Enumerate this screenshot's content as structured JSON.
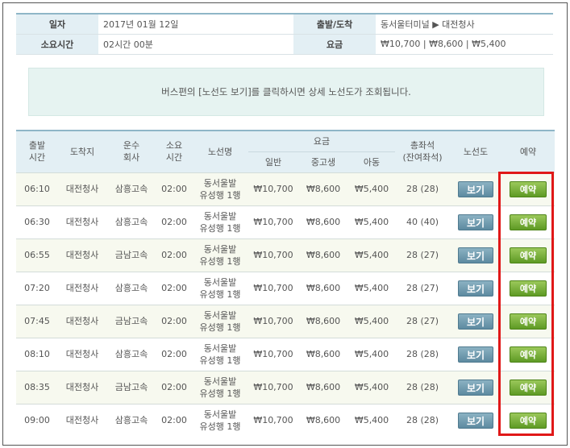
{
  "info": {
    "date_label": "일자",
    "date_value": "2017년 01월 12일",
    "route_label": "출발/도착",
    "route_value": "동서울터미널 ▶ 대전청사",
    "duration_label": "소요시간",
    "duration_value": "02시간 00분",
    "fare_label": "요금",
    "fare_value": "₩10,700 | ₩8,600 | ₩5,400"
  },
  "notice": "버스편의 [노선도 보기]를 클릭하시면 상세 노선도가 조회됩니다.",
  "headers": {
    "depart_1": "출발",
    "depart_2": "시간",
    "arrive": "도착지",
    "company_1": "운수",
    "company_2": "회사",
    "duration_1": "소요",
    "duration_2": "시간",
    "route_name": "노선명",
    "fare": "요금",
    "fare_adult": "일반",
    "fare_student": "중고생",
    "fare_child": "아동",
    "seats_1": "총좌석",
    "seats_2": "(잔여좌석)",
    "map": "노선도",
    "reserve": "예약"
  },
  "rows": [
    {
      "time": "06:10",
      "dest": "대전청사",
      "company": "삼흥고속",
      "duration": "02:00",
      "route_1": "동서울발",
      "route_2": "유성행 1행",
      "adult": "₩10,700",
      "student": "₩8,600",
      "child": "₩5,400",
      "seats": "28 (28)",
      "view": "보기",
      "book": "예약"
    },
    {
      "time": "06:30",
      "dest": "대전청사",
      "company": "삼흥고속",
      "duration": "02:00",
      "route_1": "동서울발",
      "route_2": "유성행 1행",
      "adult": "₩10,700",
      "student": "₩8,600",
      "child": "₩5,400",
      "seats": "40 (40)",
      "view": "보기",
      "book": "예약"
    },
    {
      "time": "06:55",
      "dest": "대전청사",
      "company": "금남고속",
      "duration": "02:00",
      "route_1": "동서울발",
      "route_2": "유성행 1행",
      "adult": "₩10,700",
      "student": "₩8,600",
      "child": "₩5,400",
      "seats": "28 (27)",
      "view": "보기",
      "book": "예약"
    },
    {
      "time": "07:20",
      "dest": "대전청사",
      "company": "삼흥고속",
      "duration": "02:00",
      "route_1": "동서울발",
      "route_2": "유성행 1행",
      "adult": "₩10,700",
      "student": "₩8,600",
      "child": "₩5,400",
      "seats": "28 (27)",
      "view": "보기",
      "book": "예약"
    },
    {
      "time": "07:45",
      "dest": "대전청사",
      "company": "금남고속",
      "duration": "02:00",
      "route_1": "동서울발",
      "route_2": "유성행 1행",
      "adult": "₩10,700",
      "student": "₩8,600",
      "child": "₩5,400",
      "seats": "28 (27)",
      "view": "보기",
      "book": "예약"
    },
    {
      "time": "08:10",
      "dest": "대전청사",
      "company": "삼흥고속",
      "duration": "02:00",
      "route_1": "동서울발",
      "route_2": "유성행 1행",
      "adult": "₩10,700",
      "student": "₩8,600",
      "child": "₩5,400",
      "seats": "28 (28)",
      "view": "보기",
      "book": "예약"
    },
    {
      "time": "08:35",
      "dest": "대전청사",
      "company": "금남고속",
      "duration": "02:00",
      "route_1": "동서울발",
      "route_2": "유성행 1행",
      "adult": "₩10,700",
      "student": "₩8,600",
      "child": "₩5,400",
      "seats": "28 (28)",
      "view": "보기",
      "book": "예약"
    },
    {
      "time": "09:00",
      "dest": "대전청사",
      "company": "삼흥고속",
      "duration": "02:00",
      "route_1": "동서울발",
      "route_2": "유성행 1행",
      "adult": "₩10,700",
      "student": "₩8,600",
      "child": "₩5,400",
      "seats": "28 (28)",
      "view": "보기",
      "book": "예약"
    }
  ],
  "colors": {
    "header_bg": "#e3eff4",
    "header_border": "#8fb6c7",
    "view_button": "#6f9ab0",
    "reserve_button": "#72aa34",
    "highlight": "#e01818"
  }
}
